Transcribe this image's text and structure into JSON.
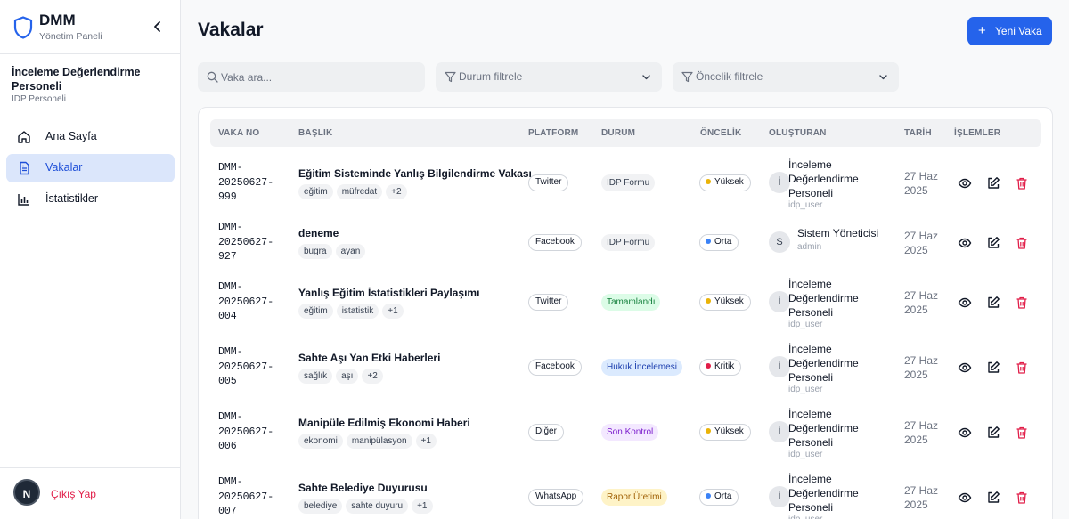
{
  "brand": {
    "title": "DMM",
    "subtitle": "Yönetim Paneli"
  },
  "user": {
    "name": "İnceleme Değerlendirme Personeli",
    "role": "IDP Personeli"
  },
  "nav": [
    {
      "label": "Ana Sayfa",
      "icon": "home-icon",
      "active": false
    },
    {
      "label": "Vakalar",
      "icon": "document-icon",
      "active": true
    },
    {
      "label": "İstatistikler",
      "icon": "bar-chart-icon",
      "active": false
    }
  ],
  "logout": {
    "avatar": "N",
    "label": "Çıkış Yap"
  },
  "page": {
    "title": "Vakalar",
    "new_button": "Yeni Vaka"
  },
  "filters": {
    "search_placeholder": "Vaka ara...",
    "status_placeholder": "Durum filtrele",
    "priority_placeholder": "Öncelik filtrele"
  },
  "table": {
    "headers": {
      "no": "VAKA NO",
      "title": "BAŞLIK",
      "platform": "PLATFORM",
      "status": "DURUM",
      "priority": "ÖNCELİK",
      "creator": "OLUŞTURAN",
      "date": "TARİH",
      "actions": "İŞLEMLER"
    },
    "rows": [
      {
        "no": "DMM-\n20250627-\n999",
        "title": "Eğitim Sisteminde Yanlış Bilgilendirme Vakası",
        "tags": [
          "eğitim",
          "müfredat",
          "+2"
        ],
        "platform": "Twitter",
        "status": "IDP Formu",
        "priority": "Yüksek",
        "creator_initial": "İ",
        "creator": "İnceleme Değerlendirme Personeli",
        "creator_user": "idp_user",
        "date": "27 Haz 2025"
      },
      {
        "no": "DMM-\n20250627-\n927",
        "title": "deneme",
        "tags": [
          "bugra",
          "ayan"
        ],
        "platform": "Facebook",
        "status": "IDP Formu",
        "priority": "Orta",
        "creator_initial": "S",
        "creator": "Sistem Yöneticisi",
        "creator_user": "admin",
        "date": "27 Haz 2025"
      },
      {
        "no": "DMM-\n20250627-\n004",
        "title": "Yanlış Eğitim İstatistikleri Paylaşımı",
        "tags": [
          "eğitim",
          "istatistik",
          "+1"
        ],
        "platform": "Twitter",
        "status": "Tamamlandı",
        "priority": "Yüksek",
        "creator_initial": "İ",
        "creator": "İnceleme Değerlendirme Personeli",
        "creator_user": "idp_user",
        "date": "27 Haz 2025"
      },
      {
        "no": "DMM-\n20250627-\n005",
        "title": "Sahte Aşı Yan Etki Haberleri",
        "tags": [
          "sağlık",
          "aşı",
          "+2"
        ],
        "platform": "Facebook",
        "status": "Hukuk İncelemesi",
        "priority": "Kritik",
        "creator_initial": "İ",
        "creator": "İnceleme Değerlendirme Personeli",
        "creator_user": "idp_user",
        "date": "27 Haz 2025"
      },
      {
        "no": "DMM-\n20250627-\n006",
        "title": "Manipüle Edilmiş Ekonomi Haberi",
        "tags": [
          "ekonomi",
          "manipülasyon",
          "+1"
        ],
        "platform": "Diğer",
        "status": "Son Kontrol",
        "priority": "Yüksek",
        "creator_initial": "İ",
        "creator": "İnceleme Değerlendirme Personeli",
        "creator_user": "idp_user",
        "date": "27 Haz 2025"
      },
      {
        "no": "DMM-\n20250627-\n007",
        "title": "Sahte Belediye Duyurusu",
        "tags": [
          "belediye",
          "sahte duyuru",
          "+1"
        ],
        "platform": "WhatsApp",
        "status": "Rapor Üretimi",
        "priority": "Orta",
        "creator_initial": "İ",
        "creator": "İnceleme Değerlendirme Personeli",
        "creator_user": "idp_user",
        "date": "27 Haz 2025"
      }
    ]
  },
  "colors": {
    "accent": "#2563eb",
    "status": {
      "IDP Formu": {
        "bg": "#f1f2f4",
        "fg": "#374151"
      },
      "Tamamlandı": {
        "bg": "#dcfce7",
        "fg": "#15803d"
      },
      "Hukuk İncelemesi": {
        "bg": "#dbeafe",
        "fg": "#1e40af"
      },
      "Son Kontrol": {
        "bg": "#f3e8ff",
        "fg": "#7e22ce"
      },
      "Rapor Üretimi": {
        "bg": "#fef3c7",
        "fg": "#a16207"
      }
    },
    "priority": {
      "Yüksek": "#eab308",
      "Orta": "#3b82f6",
      "Kritik": "#e11d48"
    }
  }
}
